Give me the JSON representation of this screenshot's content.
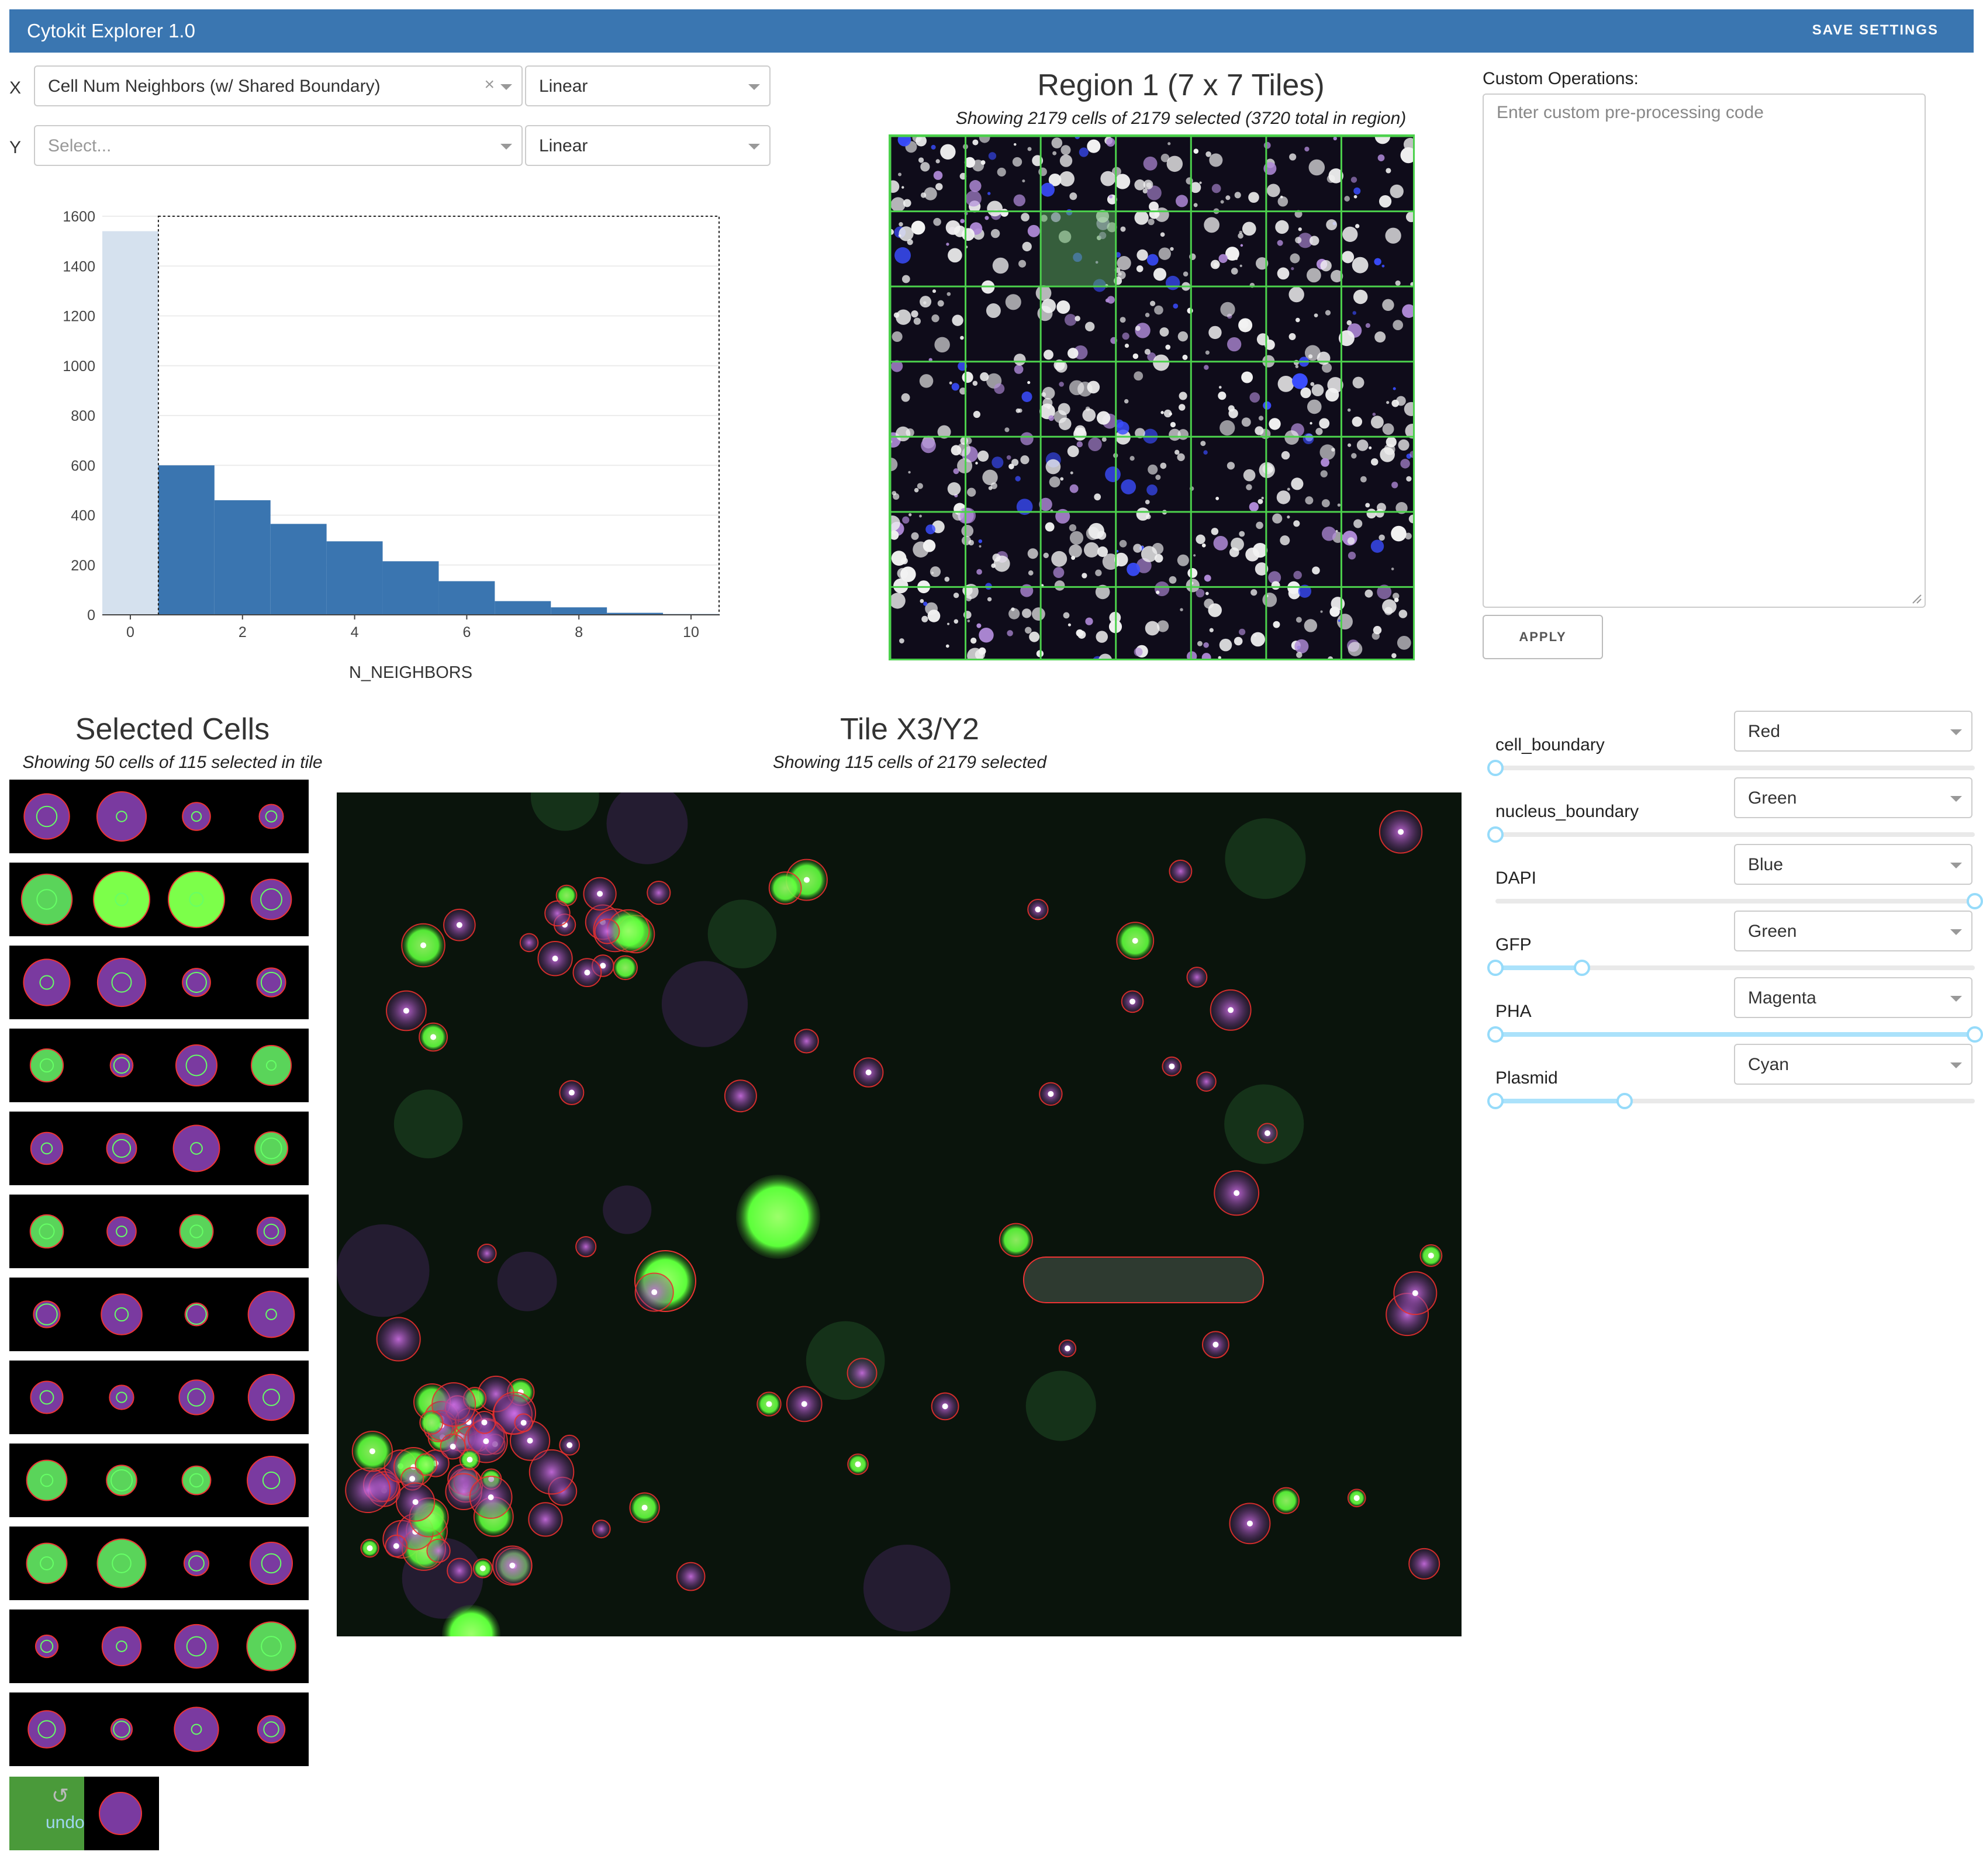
{
  "app": {
    "title": "Cytokit Explorer 1.0",
    "save_label": "SAVE SETTINGS"
  },
  "axes": {
    "x": {
      "letter": "X",
      "value": "Cell Num Neighbors (w/ Shared Boundary)",
      "clear": "×",
      "scale": "Linear"
    },
    "y": {
      "letter": "Y",
      "placeholder": "Select...",
      "scale": "Linear"
    }
  },
  "chart_data": {
    "type": "bar",
    "xlabel": "N_NEIGHBORS",
    "ylabel": "",
    "xlim": [
      -0.5,
      10.5
    ],
    "ylim": [
      0,
      1600
    ],
    "xticks": [
      "0",
      "2",
      "4",
      "6",
      "8",
      "10"
    ],
    "yticks": [
      "0",
      "200",
      "400",
      "600",
      "800",
      "1000",
      "1200",
      "1400",
      "1600"
    ],
    "selection_range": [
      0.5,
      10.5
    ],
    "bars": [
      {
        "x": 0,
        "value": 1540,
        "selected": false
      },
      {
        "x": 1,
        "value": 600,
        "selected": true
      },
      {
        "x": 2,
        "value": 460,
        "selected": true
      },
      {
        "x": 3,
        "value": 365,
        "selected": true
      },
      {
        "x": 4,
        "value": 295,
        "selected": true
      },
      {
        "x": 5,
        "value": 215,
        "selected": true
      },
      {
        "x": 6,
        "value": 135,
        "selected": true
      },
      {
        "x": 7,
        "value": 55,
        "selected": true
      },
      {
        "x": 8,
        "value": 30,
        "selected": true
      },
      {
        "x": 9,
        "value": 8,
        "selected": true
      },
      {
        "x": 10,
        "value": 3,
        "selected": true
      }
    ],
    "colors": {
      "selected": "#3a75b0",
      "unselected": "#d5e1ee"
    }
  },
  "region": {
    "title": "Region 1 (7 x 7 Tiles)",
    "subtitle": "Showing 2179 cells of 2179 selected (3720 total in region)",
    "grid_rows": 7,
    "grid_cols": 7,
    "highlighted_tile": {
      "col": 2,
      "row": 1
    },
    "grid_color": "#4cd14c"
  },
  "custom_ops": {
    "label": "Custom Operations:",
    "placeholder": "Enter custom pre-processing code",
    "apply_label": "APPLY"
  },
  "selected_cells": {
    "title": "Selected Cells",
    "subtitle": "Showing 50 cells of 115 selected in tile",
    "undo_label": "undo"
  },
  "tile": {
    "title": "Tile X3/Y2",
    "subtitle": "Showing 115 cells of 2179 selected"
  },
  "channels": [
    {
      "name": "cell_boundary",
      "color": "Red",
      "range": [
        0.0,
        0.0
      ]
    },
    {
      "name": "nucleus_boundary",
      "color": "Green",
      "range": [
        0.0,
        0.0
      ]
    },
    {
      "name": "DAPI",
      "color": "Blue",
      "range": [
        1.0,
        1.0
      ]
    },
    {
      "name": "GFP",
      "color": "Green",
      "range": [
        0.0,
        0.18
      ]
    },
    {
      "name": "PHA",
      "color": "Magenta",
      "range": [
        0.0,
        1.0
      ]
    },
    {
      "name": "Plasmid",
      "color": "Cyan",
      "range": [
        0.0,
        0.27
      ]
    }
  ]
}
